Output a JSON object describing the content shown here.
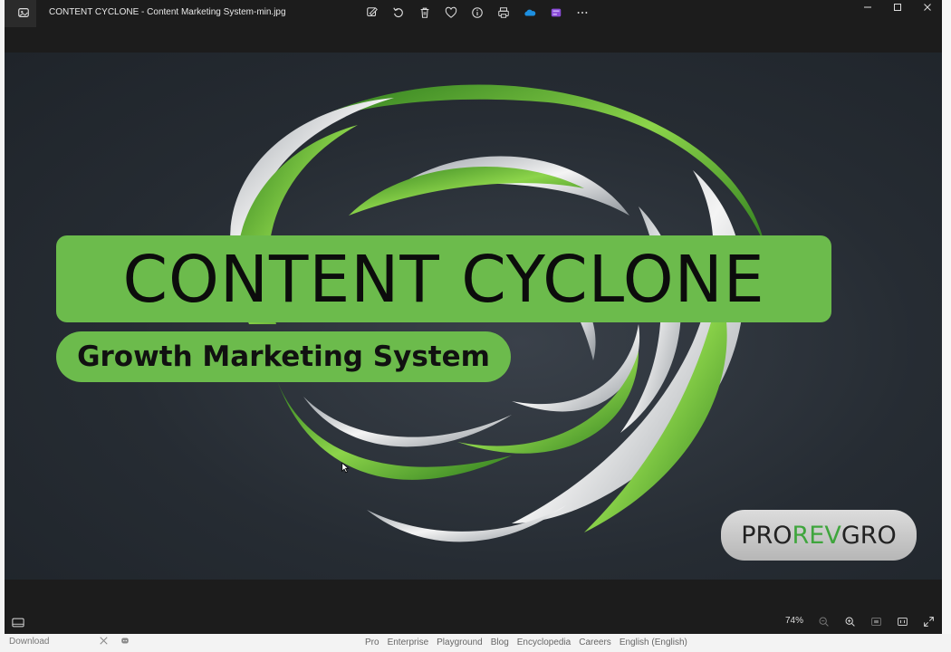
{
  "window": {
    "title": "CONTENT CYCLONE - Content Marketing System-min.jpg"
  },
  "toolbar": {
    "items": [
      {
        "name": "edit-icon"
      },
      {
        "name": "rotate-icon"
      },
      {
        "name": "delete-icon"
      },
      {
        "name": "favorite-icon"
      },
      {
        "name": "info-icon"
      },
      {
        "name": "print-icon"
      },
      {
        "name": "onedrive-icon"
      },
      {
        "name": "clipchamp-icon"
      },
      {
        "name": "more-icon"
      }
    ]
  },
  "image": {
    "headline": "CONTENT CYCLONE",
    "subheadline": "Growth Marketing System",
    "logo_pro": "PRO",
    "logo_rev": "REV",
    "logo_gro": "GRO"
  },
  "statusbar": {
    "zoom": "74%"
  },
  "background_page": {
    "download_label": "Download",
    "nav": [
      "Pro",
      "Enterprise",
      "Playground",
      "Blog",
      "Encyclopedia",
      "Careers",
      "English (English)"
    ]
  },
  "colors": {
    "accent_green": "#6cbb4c",
    "logo_green": "#3fa53d",
    "canvas_dark": "#262c33"
  }
}
